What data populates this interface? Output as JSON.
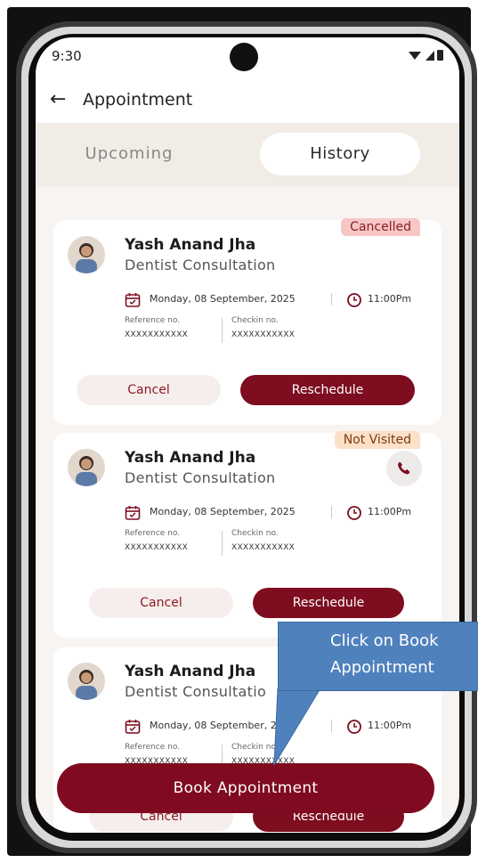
{
  "status_bar": {
    "time": "9:30"
  },
  "header": {
    "title": "Appointment"
  },
  "tabs": [
    {
      "label": "Upcoming"
    },
    {
      "label": "History"
    }
  ],
  "appointments": [
    {
      "status": "Cancelled",
      "doctor_name": "Yash Anand Jha",
      "service": "Dentist Consultation",
      "date": "Monday, 08 September, 2025",
      "time": "11:00Pm",
      "reference_label": "Reference no.",
      "reference_value": "XXXXXXXXXXX",
      "checkin_label": "Checkin no.",
      "checkin_value": "XXXXXXXXXXX",
      "cancel_label": "Cancel",
      "reschedule_label": "Reschedule"
    },
    {
      "status": "Not Visited",
      "doctor_name": "Yash Anand Jha",
      "service": "Dentist Consultation",
      "date": "Monday, 08 September, 2025",
      "time": "11:00Pm",
      "reference_label": "Reference no.",
      "reference_value": "XXXXXXXXXXX",
      "checkin_label": "Checkin no.",
      "checkin_value": "XXXXXXXXXXX",
      "cancel_label": "Cancel",
      "reschedule_label": "Reschedule"
    },
    {
      "status": "",
      "doctor_name": "Yash Anand Jha",
      "service": "Dentist Consultatio",
      "date": "Monday, 08 September, 2",
      "time": "11:00Pm",
      "reference_label": "Reference no.",
      "reference_value": "XXXXXXXXXXX",
      "checkin_label": "Checkin no.",
      "checkin_value": "XXXXXXXXXXX",
      "cancel_label": "Cancel",
      "reschedule_label": "Reschedule"
    }
  ],
  "book_button": {
    "label": "Book Appointment"
  },
  "callout": {
    "line1": "Click on Book",
    "line2": "Appointment"
  },
  "colors": {
    "brand": "#7d0d1f",
    "cancelled_badge": "#f7c7c6",
    "not_visited_badge": "#fde0c8",
    "callout": "#4f81bd"
  },
  "icons": {
    "back": "arrow-left-icon",
    "calendar": "calendar-icon",
    "clock": "clock-icon",
    "call": "phone-icon"
  }
}
